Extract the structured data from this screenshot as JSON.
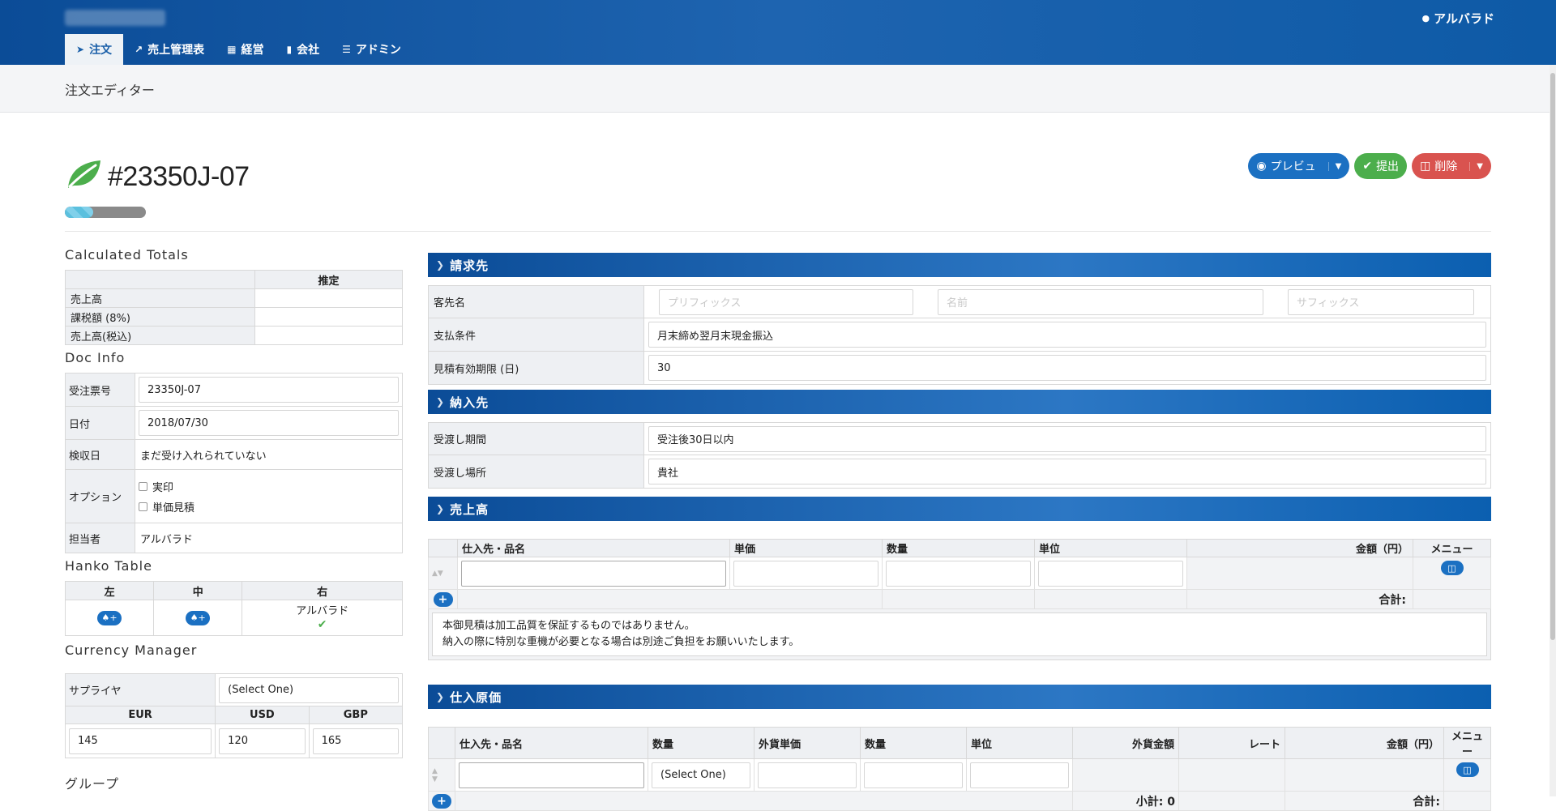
{
  "header": {
    "user_name": "アルバラド",
    "nav": [
      "注文",
      "売上管理表",
      "経営",
      "会社",
      "アドミン"
    ]
  },
  "page": {
    "crumb": "注文エディター",
    "order_number": "#23350J-07",
    "progress_percent": 35
  },
  "actions": {
    "preview": "プレビュ",
    "submit": "提出",
    "delete": "削除"
  },
  "totals": {
    "heading": "Calculated Totals",
    "col": "推定",
    "rows": [
      "売上高",
      "課税額 (8%)",
      "売上高(税込)"
    ]
  },
  "docinfo": {
    "heading": "Doc Info",
    "order_label": "受注票号",
    "order_value": "23350J-07",
    "date_label": "日付",
    "date_value": "2018/07/30",
    "inspect_label": "検収日",
    "inspect_value": "まだ受け入れられていない",
    "options_label": "オプション",
    "opt1": "実印",
    "opt2": "単価見積",
    "staff_label": "担当者",
    "staff_value": "アルバラド"
  },
  "hanko": {
    "heading": "Hanko Table",
    "cols": [
      "左",
      "中",
      "右"
    ],
    "right_name": "アルバラド"
  },
  "currency": {
    "heading": "Currency Manager",
    "supplier_label": "サプライヤ",
    "supplier_value": "(Select One)",
    "cols": [
      "EUR",
      "USD",
      "GBP"
    ],
    "values": [
      "145",
      "120",
      "165"
    ]
  },
  "group_heading": "グループ",
  "billing": {
    "title": "請求先",
    "name_label": "客先名",
    "ph_prefix": "プリフィックス",
    "ph_name": "名前",
    "ph_suffix": "サフィックス",
    "terms_label": "支払条件",
    "terms_value": "月末締め翌月末現金振込",
    "valid_label": "見積有効期限 (日)",
    "valid_value": "30"
  },
  "delivery": {
    "title": "納入先",
    "period_label": "受渡し期間",
    "period_value": "受注後30日以内",
    "place_label": "受渡し場所",
    "place_value": "貴社"
  },
  "sales": {
    "title": "売上高",
    "cols": [
      "仕入先・品名",
      "単価",
      "数量",
      "単位",
      "金額（円）",
      "メニュー"
    ],
    "total_label": "合計:",
    "note1": "本御見積は加工品質を保証するものではありません。",
    "note2": "納入の際に特別な重機が必要となる場合は別途ご負担をお願いいたします。"
  },
  "purchase": {
    "title": "仕入原価",
    "cols": [
      "仕入先・品名",
      "数量",
      "外貨単価",
      "数量",
      "単位",
      "外貨金額",
      "レート",
      "金額（円）",
      "メニュー"
    ],
    "select_value": "(Select One)",
    "subtotal_label": "小計: 0",
    "total_label": "合計:"
  }
}
